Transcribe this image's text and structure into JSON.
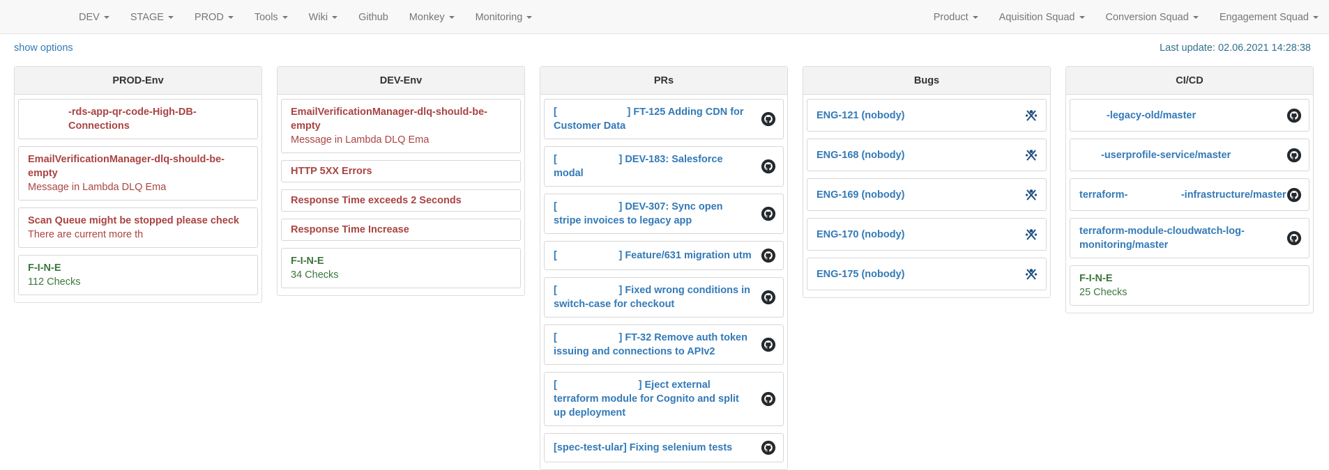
{
  "nav": {
    "left": [
      {
        "label": "DEV",
        "dropdown": true
      },
      {
        "label": "STAGE",
        "dropdown": true
      },
      {
        "label": "PROD",
        "dropdown": true
      },
      {
        "label": "Tools",
        "dropdown": true
      },
      {
        "label": "Wiki",
        "dropdown": true
      },
      {
        "label": "Github",
        "dropdown": false
      },
      {
        "label": "Monkey",
        "dropdown": true
      },
      {
        "label": "Monitoring",
        "dropdown": true
      }
    ],
    "right": [
      {
        "label": "Product",
        "dropdown": true
      },
      {
        "label": "Aquisition Squad",
        "dropdown": true
      },
      {
        "label": "Conversion Squad",
        "dropdown": true
      },
      {
        "label": "Engagement Squad",
        "dropdown": true
      }
    ]
  },
  "toolbar": {
    "show_options": "show options",
    "last_update": "Last update: 02.06.2021 14:28:38"
  },
  "panels": {
    "prod": {
      "title": "PROD-Env",
      "cards": [
        {
          "title": "-rds-app-qr-code-High-DB-Connections",
          "sub": ""
        },
        {
          "title": "EmailVerificationManager-dlq-should-be-empty",
          "sub": "Message in Lambda DLQ Ema"
        },
        {
          "title": "Scan Queue might be stopped please check",
          "sub": "There are current more th"
        },
        {
          "title": "F-I-N-E",
          "sub": "112 Checks"
        }
      ]
    },
    "dev": {
      "title": "DEV-Env",
      "cards": [
        {
          "title": "EmailVerificationManager-dlq-should-be-empty",
          "sub": "Message in Lambda DLQ Ema"
        },
        {
          "title": "HTTP 5XX Errors",
          "sub": ""
        },
        {
          "title": "Response Time exceeds 2 Seconds",
          "sub": ""
        },
        {
          "title": "Response Time Increase",
          "sub": ""
        },
        {
          "title": "F-I-N-E",
          "sub": "34 Checks"
        }
      ]
    },
    "prs": {
      "title": "PRs",
      "items": [
        "[                         ] FT-125 Adding CDN for Customer Data",
        "[                      ] DEV-183: Salesforce modal",
        "[                      ] DEV-307: Sync open stripe invoices to legacy app",
        "[                      ] Feature/631 migration utm",
        "[                      ] Fixed wrong conditions in switch-case for checkout",
        "[                      ] FT-32 Remove auth token issuing and connections to APIv2",
        "[                             ] Eject external terraform module for Cognito and split up deployment",
        "[spec-test-ular] Fixing selenium tests"
      ]
    },
    "bugs": {
      "title": "Bugs",
      "items": [
        "ENG-121 (nobody)",
        "ENG-168 (nobody)",
        "ENG-169 (nobody)",
        "ENG-170 (nobody)",
        "ENG-175 (nobody)"
      ]
    },
    "cicd": {
      "title": "CI/CD",
      "items": [
        "-legacy-old/master",
        "-userprofile-service/master",
        "terraform-                   -infrastructure/master",
        "terraform-module-cloudwatch-log-monitoring/master"
      ],
      "fine": {
        "title": "F-I-N-E",
        "sub": "25 Checks"
      }
    }
  },
  "icons": {
    "pr": "github-icon",
    "bug": "jira-icon",
    "ci": "github-icon"
  },
  "colors": {
    "error": "#a94442",
    "ok": "#3c763d",
    "link": "#337ab7",
    "navbar_bg": "#f8f8f8"
  }
}
